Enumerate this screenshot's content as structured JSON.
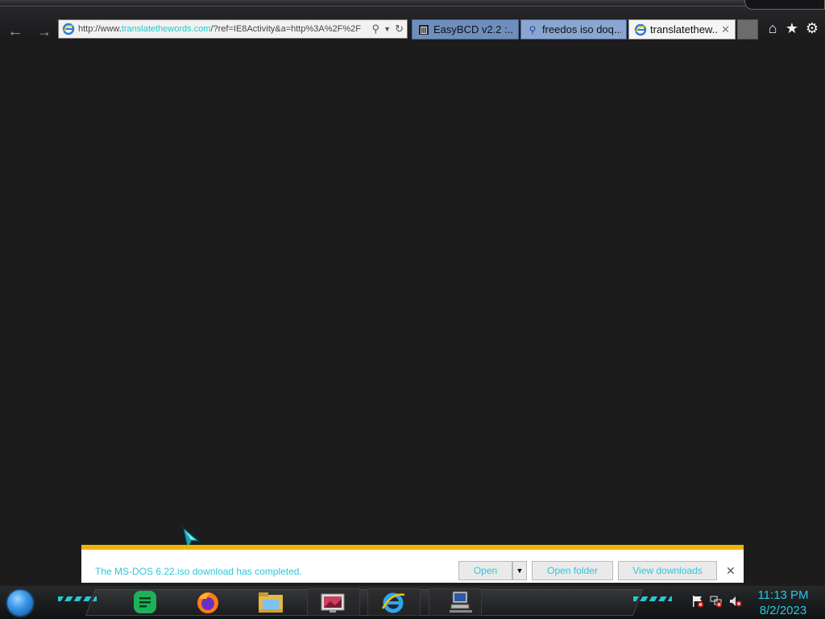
{
  "browser": {
    "address_bar": {
      "url_prefix": "http://www.",
      "url_domain": "translatethewords.com",
      "url_rest": "/?ref=IE8Activity&a=http%3A%2F%2F"
    },
    "tabs": [
      {
        "label": "EasyBCD v2.2 :...",
        "icon": "trash-can-icon",
        "active": false
      },
      {
        "label": "freedos iso doq...",
        "icon": "search-icon",
        "active": false
      },
      {
        "label": "translatethew...",
        "icon": "ie-icon",
        "active": true
      }
    ]
  },
  "download_bar": {
    "message": "The MS-DOS 6.22.iso download has completed.",
    "open_label": "Open",
    "open_folder_label": "Open folder",
    "view_downloads_label": "View downloads",
    "accent_color": "#f0b400",
    "text_color": "#30c6d8"
  },
  "taskbar": {
    "apps": [
      "google-sheets-icon",
      "firefox-icon",
      "file-explorer-icon",
      "picture-viewer-icon",
      "internet-explorer-icon",
      "network-computer-icon"
    ],
    "clock": {
      "time": "11:13 PM",
      "date": "8/2/2023"
    },
    "clock_color": "#23c9e6"
  }
}
